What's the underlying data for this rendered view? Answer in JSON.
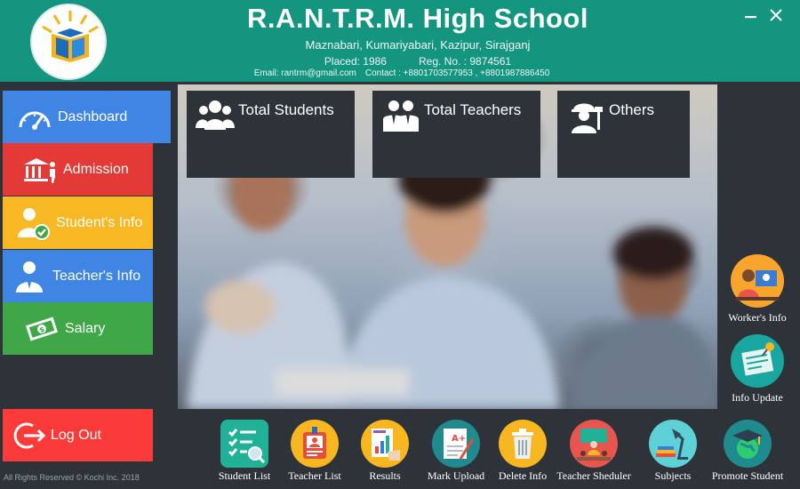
{
  "header": {
    "title": "R.A.N.T.R.M. High School",
    "address": "Maznabari, Kumariyabari, Kazipur, Sirajganj",
    "placed": "Placed: 1986",
    "reg": "Reg. No. : 9874561",
    "email": "Email: rantrm@gmail.com",
    "contact": "Contact : +8801703577953 , +8801987886450",
    "colors": {
      "header_bg": "#13957f"
    }
  },
  "sidebar": {
    "items": [
      {
        "label": "Dashboard",
        "icon": "speedometer-icon",
        "color": "#3f86e4"
      },
      {
        "label": "Admission",
        "icon": "institution-icon",
        "color": "#e33a38"
      },
      {
        "label": "Student's Info",
        "icon": "student-check-icon",
        "color": "#f7b823"
      },
      {
        "label": "Teacher's Info",
        "icon": "teacher-icon",
        "color": "#3f86e4"
      },
      {
        "label": "Salary",
        "icon": "money-icon",
        "color": "#3fa748"
      }
    ],
    "logout": "Log Out",
    "copyright": "All Rights Reserved © Kochi Inc. 2018"
  },
  "tiles": [
    {
      "label": "Total Students",
      "icon": "students-group-icon"
    },
    {
      "label": "Total Teachers",
      "icon": "teachers-group-icon"
    },
    {
      "label": "Others",
      "icon": "worker-icon"
    }
  ],
  "right_panel": [
    {
      "label": "Worker's Info",
      "icon": "worker-meeting-icon"
    },
    {
      "label": "Info Update",
      "icon": "note-pin-icon"
    }
  ],
  "bottom_bar": [
    {
      "label": "Student List",
      "icon": "checklist-search-icon"
    },
    {
      "label": "Teacher List",
      "icon": "id-card-icon"
    },
    {
      "label": "Results",
      "icon": "results-chart-icon"
    },
    {
      "label": "Mark Upload",
      "icon": "grade-paper-icon"
    },
    {
      "label": "Delete Info",
      "icon": "trash-icon"
    },
    {
      "label": "Teacher Sheduler",
      "icon": "classroom-icon"
    },
    {
      "label": "Subjects",
      "icon": "desk-lamp-books-icon"
    },
    {
      "label": "Promote Student",
      "icon": "graduation-globe-icon"
    }
  ]
}
